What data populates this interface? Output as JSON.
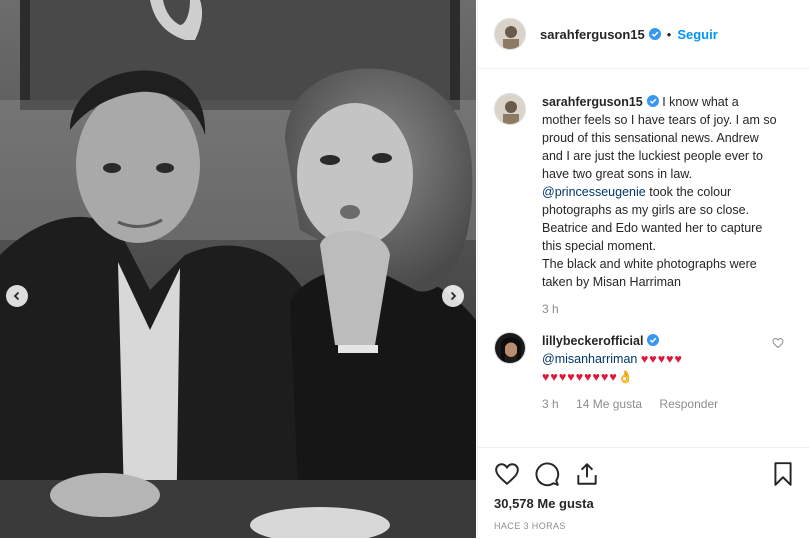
{
  "post": {
    "username": "sarahferguson15",
    "follow_label": "Seguir",
    "dot": "•",
    "caption_text": "I know what a mother feels so I have tears of joy. I am so proud of this sensational news. Andrew and I are just the luckiest people ever to have two great sons in law.",
    "caption_mention": "@princesseugenie",
    "caption_text_2": "took the colour photographs as my girls are so close. Beatrice and Edo wanted her to capture this special moment.",
    "caption_text_3": "The black and white photographs were taken by Misan Harriman",
    "caption_time": "3 h"
  },
  "comment": {
    "username": "lillybeckerofficial",
    "mention": "@misanharriman",
    "hearts_line1": "♥♥♥♥♥",
    "hearts_line2": "♥♥♥♥♥♥♥♥♥",
    "ok_emoji": "👌",
    "time": "3 h",
    "likes": "14 Me gusta",
    "reply": "Responder"
  },
  "footer": {
    "likes": "30,578 Me gusta",
    "time": "HACE 3 HORAS"
  },
  "icons": {
    "verified": "verified-badge-icon",
    "prev": "chevron-left-icon",
    "next": "chevron-right-icon",
    "like": "heart-icon",
    "comment": "comment-bubble-icon",
    "share": "share-icon",
    "save": "bookmark-icon"
  },
  "colors": {
    "link": "#0095f6",
    "mention": "#00376b",
    "heart": "#e0173a",
    "muted": "#8e8e8e"
  }
}
